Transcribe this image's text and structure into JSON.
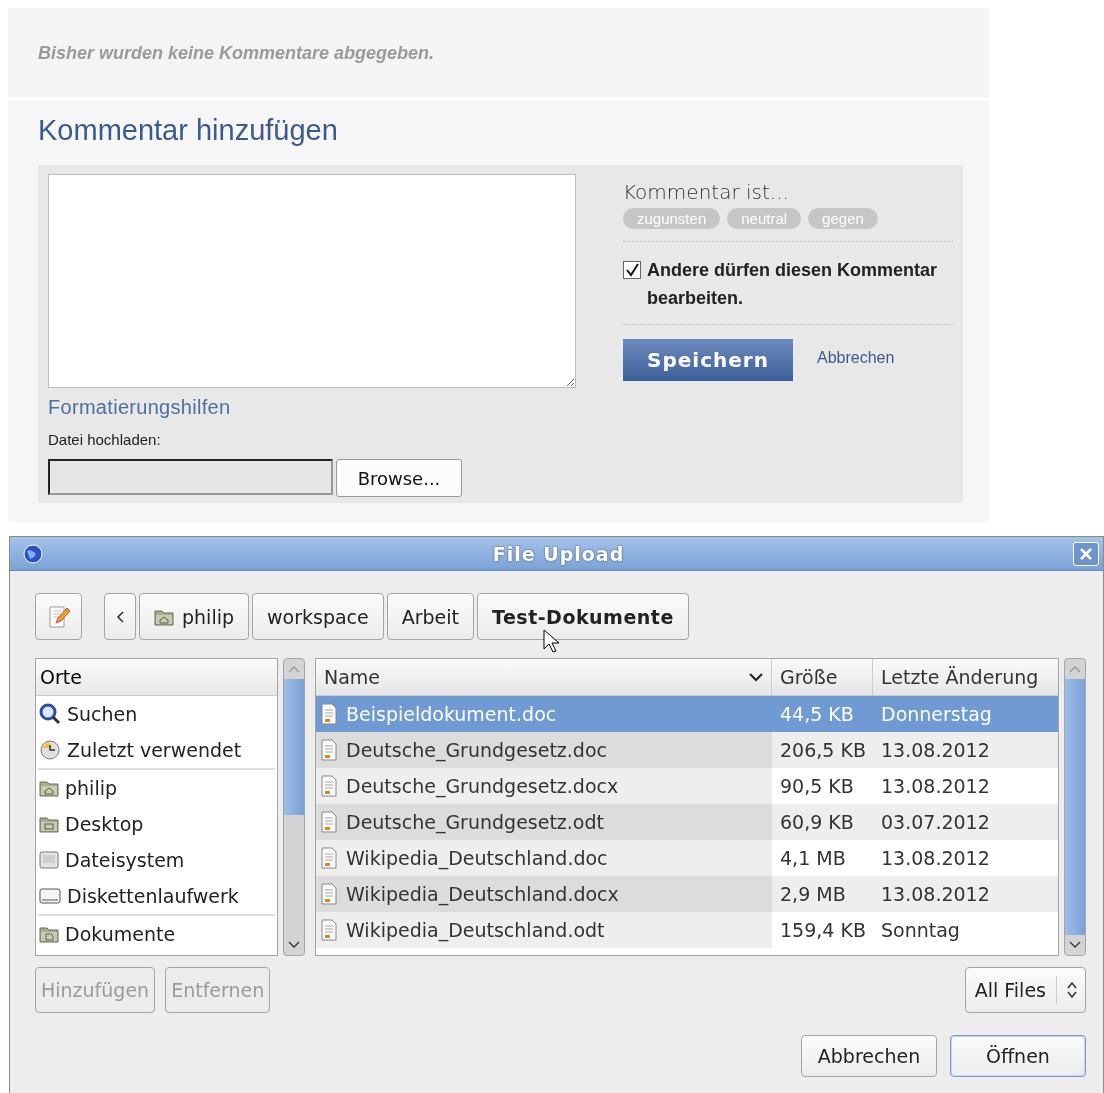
{
  "comments": {
    "empty_message": "Bisher wurden keine Kommentare abgegeben."
  },
  "add_comment": {
    "heading": "Kommentar hinzufügen",
    "formatting_link": "Formatierungshilfen",
    "upload_label": "Datei hochladen:",
    "browse_button": "Browse...",
    "stance": {
      "label": "Kommentar ist...",
      "options": [
        {
          "label": "zugunsten",
          "selected": false
        },
        {
          "label": "neutral",
          "selected": false
        },
        {
          "label": "gegen",
          "selected": false
        }
      ]
    },
    "editable": {
      "label": "Andere dürfen diesen Kommentar bearbeiten.",
      "checked": true
    },
    "save_button": "Speichern",
    "cancel_link": "Abbrechen"
  },
  "dialog": {
    "title": "File Upload",
    "path": [
      {
        "label": "philip",
        "kind": "home",
        "selected": false
      },
      {
        "label": "workspace",
        "kind": "plain",
        "selected": false
      },
      {
        "label": "Arbeit",
        "kind": "plain",
        "selected": false
      },
      {
        "label": "Test-Dokumente",
        "kind": "plain",
        "selected": true
      }
    ],
    "places": {
      "header": "Orte",
      "sections": [
        {
          "items": [
            {
              "label": "Suchen",
              "kind": "search"
            },
            {
              "label": "Zuletzt verwendet",
              "kind": "recent"
            }
          ]
        },
        {
          "items": [
            {
              "label": "philip",
              "kind": "home"
            },
            {
              "label": "Desktop",
              "kind": "desktop"
            },
            {
              "label": "Dateisystem",
              "kind": "drive"
            },
            {
              "label": "Diskettenlaufwerk",
              "kind": "floppy"
            }
          ]
        },
        {
          "items": [
            {
              "label": "Dokumente",
              "kind": "documents"
            }
          ]
        }
      ]
    },
    "places_buttons": [
      {
        "label": "Hinzufügen",
        "disabled": true
      },
      {
        "label": "Entfernen",
        "disabled": true
      }
    ],
    "files": {
      "columns": [
        "Name",
        "Größe",
        "Letzte Änderung"
      ],
      "rows": [
        {
          "name": "Beispieldokument.doc",
          "size": "44,5 KB",
          "modified": "Donnerstag",
          "selected": true
        },
        {
          "name": "Deutsche_Grundgesetz.doc",
          "size": "206,5 KB",
          "modified": "13.08.2012",
          "selected": false
        },
        {
          "name": "Deutsche_Grundgesetz.docx",
          "size": "90,5 KB",
          "modified": "13.08.2012",
          "selected": false
        },
        {
          "name": "Deutsche_Grundgesetz.odt",
          "size": "60,9 KB",
          "modified": "03.07.2012",
          "selected": false
        },
        {
          "name": "Wikipedia_Deutschland.doc",
          "size": "4,1 MB",
          "modified": "13.08.2012",
          "selected": false
        },
        {
          "name": "Wikipedia_Deutschland.docx",
          "size": "2,9 MB",
          "modified": "13.08.2012",
          "selected": false
        },
        {
          "name": "Wikipedia_Deutschland.odt",
          "size": "159,4 KB",
          "modified": "Sonntag",
          "selected": false
        }
      ]
    },
    "filter": "All Files",
    "buttons": [
      {
        "label": "Abbrechen",
        "default": false
      },
      {
        "label": "Öffnen",
        "default": true
      }
    ]
  }
}
